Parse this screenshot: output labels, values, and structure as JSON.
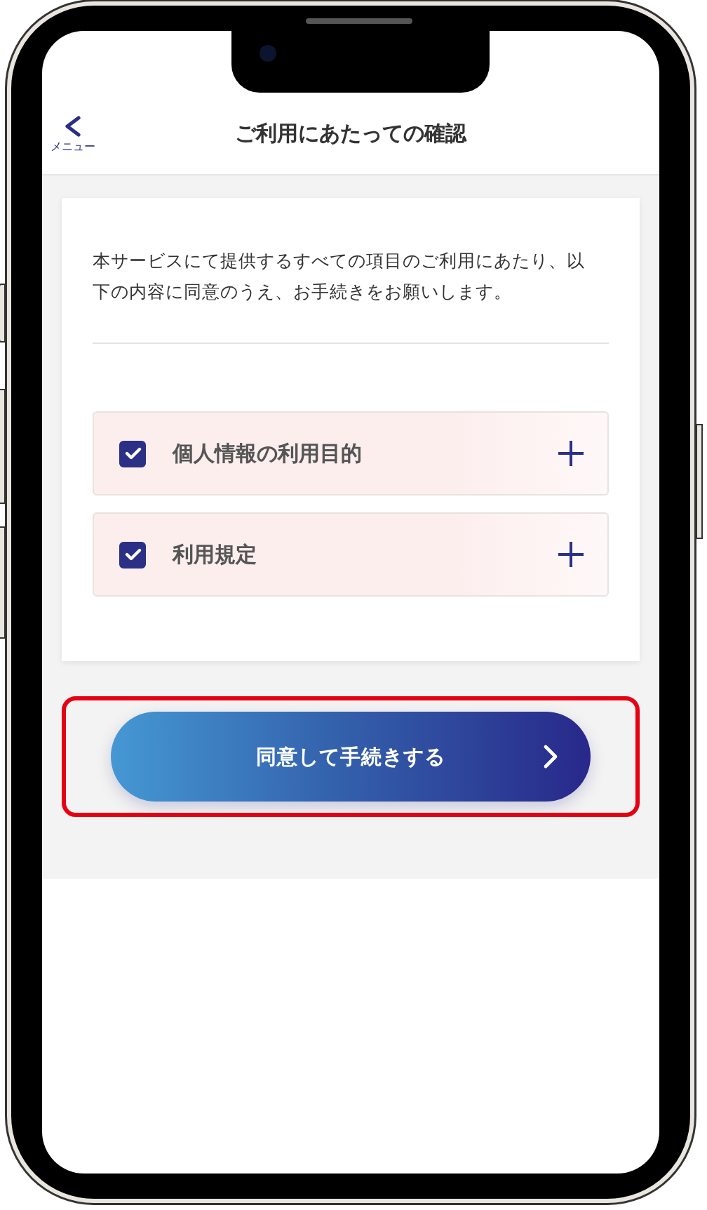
{
  "header": {
    "back_label": "メニュー",
    "title": "ご利用にあたっての確認"
  },
  "intro": "本サービスにて提供するすべての項目のご利用にあたり、以下の内容に同意のうえ、お手続きをお願いします。",
  "items": [
    {
      "label": "個人情報の利用目的",
      "checked": true,
      "expanded": false
    },
    {
      "label": "利用規定",
      "checked": true,
      "expanded": false
    }
  ],
  "button": {
    "label": "同意して手続きする",
    "highlighted": true
  }
}
